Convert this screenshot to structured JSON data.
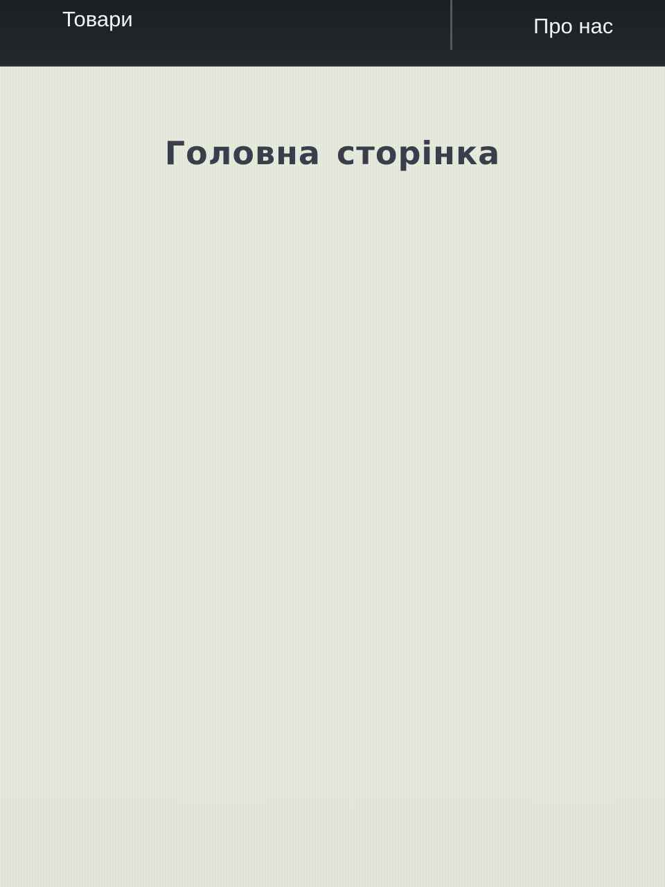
{
  "nav": {
    "products_label": "Товари",
    "about_label": "Про нас"
  },
  "main": {
    "title": "Головна сторінка"
  },
  "colors": {
    "nav_background": "#1f2328",
    "nav_text": "#f1f3f4",
    "page_background": "#e6e8da",
    "title_text": "#393f4a"
  }
}
